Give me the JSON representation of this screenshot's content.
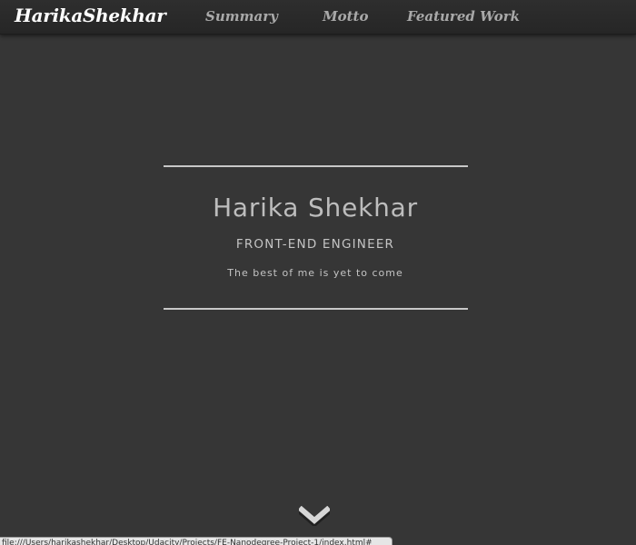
{
  "navbar": {
    "brand": "HarikaShekhar",
    "links": [
      {
        "label": "Summary"
      },
      {
        "label": "Motto"
      },
      {
        "label": "Featured Work"
      }
    ]
  },
  "hero": {
    "name": "Harika Shekhar",
    "role": "FRONT-END ENGINEER",
    "tagline": "The best of me is yet to come"
  },
  "scroll": {
    "icon": "chevron-down-icon"
  },
  "statusbar": {
    "url": "file:///Users/harikashekhar/Desktop/Udacity/Projects/FE-Nanodegree-Project-1/index.html#"
  },
  "colors": {
    "background": "#363636",
    "navbar": "#2a2a2a",
    "brand": "#ffffff",
    "nav_link": "#a9a9a9",
    "text": "#c4c4c4",
    "rule": "#c8c8c8"
  }
}
